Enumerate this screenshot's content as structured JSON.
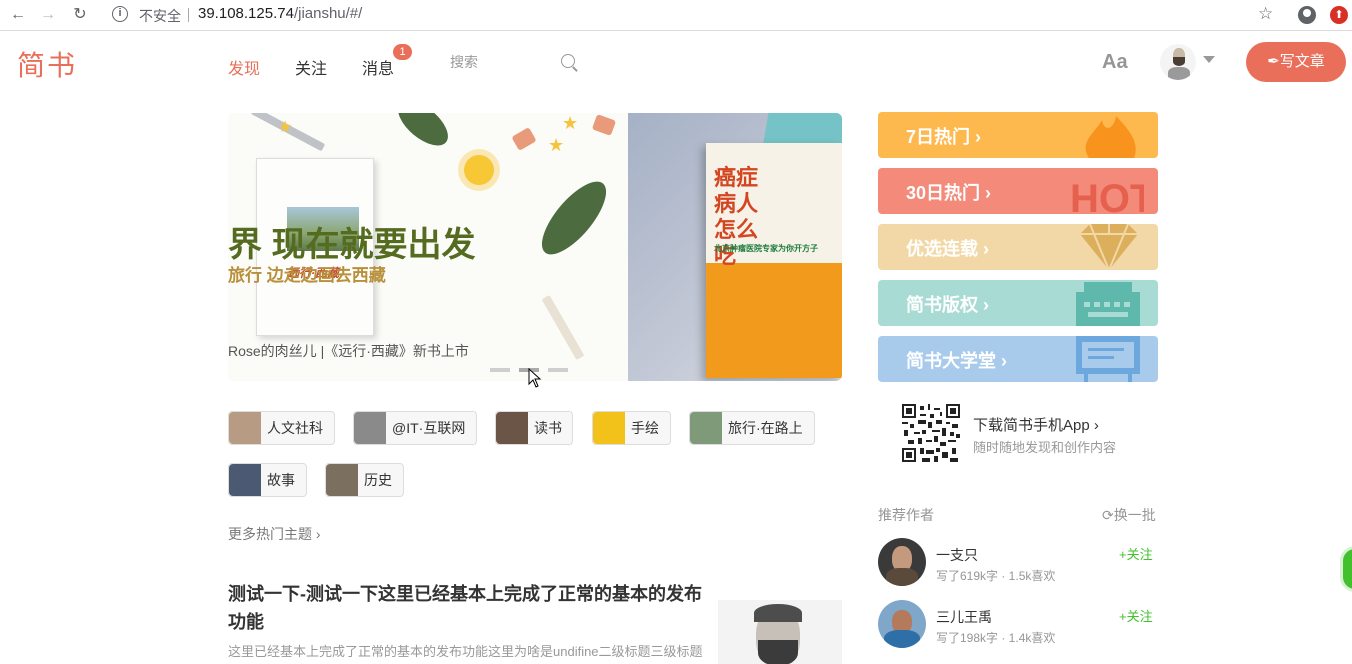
{
  "browser": {
    "insecure_label": "不安全",
    "url_host": "39.108.125.74",
    "url_path": "/jianshu/#/"
  },
  "header": {
    "logo": "简书",
    "nav": [
      {
        "label": "发现",
        "active": true
      },
      {
        "label": "关注",
        "active": false
      },
      {
        "label": "消息",
        "active": false
      }
    ],
    "message_badge": "1",
    "search_placeholder": "搜索",
    "font_toggle": "Aa",
    "write_button": "写文章",
    "accent_color": "#ea6f5a"
  },
  "banner": {
    "headline": "界      现在就要出发",
    "subline": "旅行          边走边画去西藏",
    "caption": "Rose的肉丝儿 |《远行·西藏》新书上市",
    "left_book_title": "远行·西藏",
    "right_book_title": "癌症病人怎么吃",
    "right_book_subtitle": "北京肿瘤医院专家为你开方子",
    "slides": 3,
    "active_slide": 2
  },
  "topics": [
    {
      "label": "人文社科",
      "thumb_color": "#b79b83"
    },
    {
      "label": "@IT·互联网",
      "thumb_color": "#8a8a8a"
    },
    {
      "label": "读书",
      "thumb_color": "#6b5547"
    },
    {
      "label": "手绘",
      "thumb_color": "#f2c21b"
    },
    {
      "label": "旅行·在路上",
      "thumb_color": "#7f9a78"
    },
    {
      "label": "故事",
      "thumb_color": "#4b5a72"
    },
    {
      "label": "历史",
      "thumb_color": "#7b6f60"
    }
  ],
  "more_topics": "更多热门主题",
  "article": {
    "title": "测试一下-测试一下这里已经基本上完成了正常的基本的发布功能",
    "abstract": "这里已经基本上完成了正常的基本的发布功能这里为啥是undifine二级标题三级标题"
  },
  "boards": [
    {
      "label": "7日热门",
      "color": "#fdb84e",
      "icon": "fire-icon"
    },
    {
      "label": "30日热门",
      "color": "#f38a7a",
      "icon": "hot-icon"
    },
    {
      "label": "优选连载",
      "color": "#f2d8a7",
      "icon": "diamond-icon"
    },
    {
      "label": "简书版权",
      "color": "#a9dbd5",
      "icon": "typewriter-icon"
    },
    {
      "label": "简书大学堂",
      "color": "#a8cbec",
      "icon": "blackboard-icon"
    }
  ],
  "app_download": {
    "title": "下载简书手机App",
    "subtitle": "随时随地发现和创作内容"
  },
  "recommend": {
    "title": "推荐作者",
    "refresh": "换一批",
    "authors": [
      {
        "name": "一支只",
        "meta": "写了619k字 · 1.5k喜欢",
        "follow": "+关注"
      },
      {
        "name": "三儿王禹",
        "meta": "写了198k字 · 1.4k喜欢",
        "follow": "+关注"
      }
    ]
  }
}
